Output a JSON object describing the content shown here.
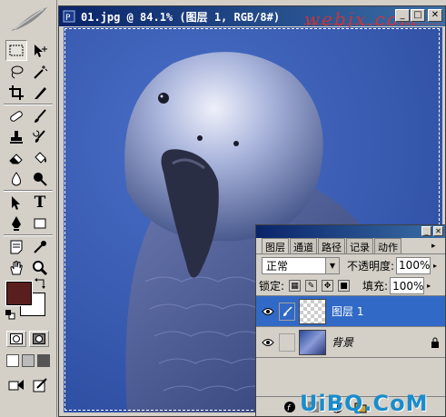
{
  "document": {
    "title": "01.jpg @ 84.1% (图层 1, RGB/8#)",
    "watermark": "webjx.com",
    "minimize_label": "_",
    "maximize_label": "□",
    "close_label": "✕"
  },
  "toolbox": {
    "tools": [
      "marquee-tool",
      "move-tool",
      "lasso-tool",
      "magic-wand-tool",
      "crop-tool",
      "slice-tool",
      "healing-brush-tool",
      "brush-tool",
      "clone-stamp-tool",
      "history-brush-tool",
      "eraser-tool",
      "paint-bucket-tool",
      "blur-tool",
      "dodge-tool",
      "path-selection-tool",
      "type-tool",
      "pen-tool",
      "shape-tool",
      "notes-tool",
      "eyedropper-tool",
      "hand-tool",
      "zoom-tool"
    ],
    "type_glyph": "T",
    "foreground_color": "#5b1e1e",
    "background_color": "#ffffff"
  },
  "layers_panel": {
    "tabs": [
      "图层",
      "通道",
      "路径",
      "记录",
      "动作"
    ],
    "active_tab": "图层",
    "blend_mode": "正常",
    "opacity_label": "不透明度:",
    "opacity_value": "100%",
    "lock_label": "锁定:",
    "fill_label": "填充:",
    "fill_value": "100%",
    "layers": [
      {
        "name": "图层 1",
        "selected": true,
        "visible": true,
        "transparent": true
      },
      {
        "name": "背景",
        "selected": false,
        "visible": true,
        "locked": true
      }
    ],
    "menu_arrow": "▸"
  },
  "site_mark": "UiBQ.CoM",
  "colors": {
    "accent": "#3169c6",
    "titlebar": "#0a246a",
    "photo_bg": "#3a5fb8"
  }
}
